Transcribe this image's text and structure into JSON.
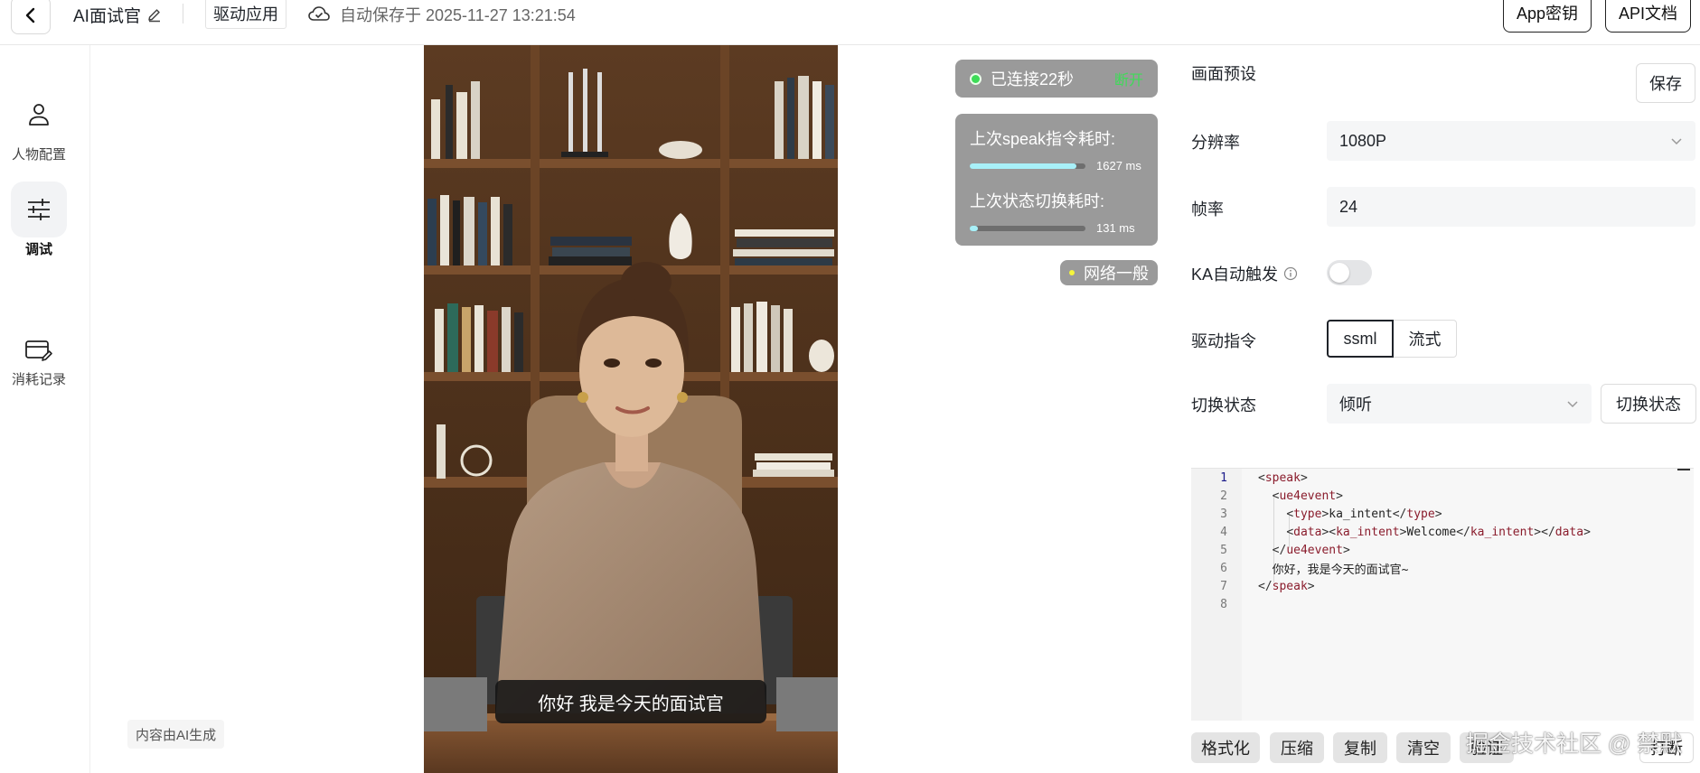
{
  "topbar": {
    "app_name": "AI面试官",
    "drive_tag": "驱动应用",
    "autosave_text": "自动保存于 2025-11-27 13:21:54",
    "app_key_button": "App密钥",
    "api_doc_button": "API文档"
  },
  "sidebar": {
    "items": [
      {
        "label": "人物配置",
        "icon": "person-icon",
        "active": false
      },
      {
        "label": "调试",
        "icon": "sliders-icon",
        "active": true
      },
      {
        "label": "消耗记录",
        "icon": "card-edit-icon",
        "active": false
      }
    ]
  },
  "ai_badge": "内容由AI生成",
  "video": {
    "subtitle": "你好 我是今天的面试官"
  },
  "status": {
    "connection_text": "已连接22秒",
    "connection_badge": "断开",
    "speak_latency_label": "上次speak指令耗时:",
    "speak_latency_value": "1627 ms",
    "speak_latency_fraction": 0.92,
    "state_latency_label": "上次状态切换耗时:",
    "state_latency_value": "131 ms",
    "state_latency_fraction": 0.07,
    "network_text": "网络一般",
    "colors": {
      "connected": "#3ddc57",
      "network": "#f5f53b",
      "panel_bg": "#9a9a9a"
    }
  },
  "settings": {
    "section_title": "画面预设",
    "save_button": "保存",
    "resolution_label": "分辨率",
    "resolution_value": "1080P",
    "framerate_label": "帧率",
    "framerate_value": "24",
    "ka_label": "KA自动触发",
    "ka_enabled": false,
    "command_label": "驱动指令",
    "command_options": [
      "ssml",
      "流式"
    ],
    "command_selected": "ssml",
    "state_label": "切换状态",
    "state_value": "倾听",
    "switch_state_button": "切换状态"
  },
  "editor": {
    "line_numbers": [
      "1",
      "2",
      "3",
      "4",
      "5",
      "6",
      "7",
      "8"
    ]
  },
  "tools": {
    "format": "格式化",
    "compress": "压缩",
    "copy": "复制",
    "clear": "清空",
    "validate": "验证",
    "interrupt": "打断"
  },
  "watermark": "掘金技术社区 @ 禁默"
}
